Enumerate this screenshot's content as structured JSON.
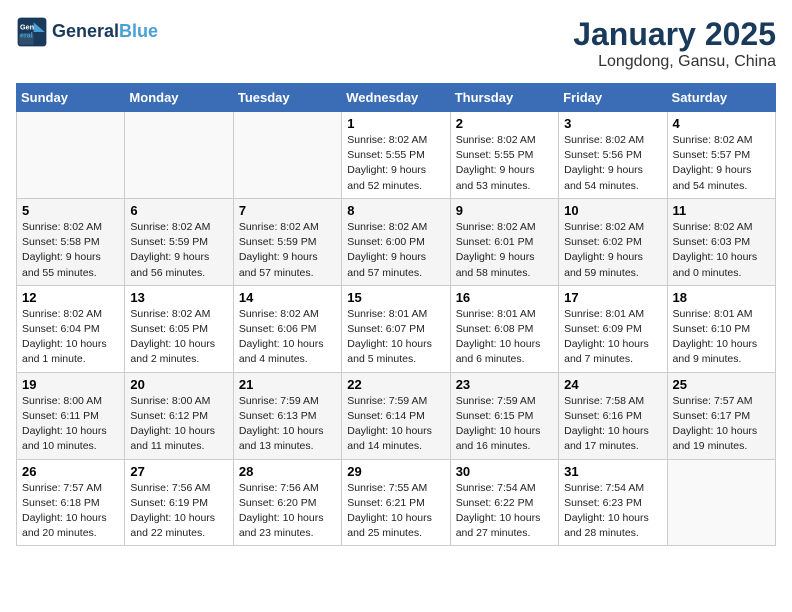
{
  "header": {
    "logo_line1": "General",
    "logo_line2": "Blue",
    "title": "January 2025",
    "subtitle": "Longdong, Gansu, China"
  },
  "weekdays": [
    "Sunday",
    "Monday",
    "Tuesday",
    "Wednesday",
    "Thursday",
    "Friday",
    "Saturday"
  ],
  "weeks": [
    [
      {
        "day": "",
        "info": ""
      },
      {
        "day": "",
        "info": ""
      },
      {
        "day": "",
        "info": ""
      },
      {
        "day": "1",
        "info": "Sunrise: 8:02 AM\nSunset: 5:55 PM\nDaylight: 9 hours and 52 minutes."
      },
      {
        "day": "2",
        "info": "Sunrise: 8:02 AM\nSunset: 5:55 PM\nDaylight: 9 hours and 53 minutes."
      },
      {
        "day": "3",
        "info": "Sunrise: 8:02 AM\nSunset: 5:56 PM\nDaylight: 9 hours and 54 minutes."
      },
      {
        "day": "4",
        "info": "Sunrise: 8:02 AM\nSunset: 5:57 PM\nDaylight: 9 hours and 54 minutes."
      }
    ],
    [
      {
        "day": "5",
        "info": "Sunrise: 8:02 AM\nSunset: 5:58 PM\nDaylight: 9 hours and 55 minutes."
      },
      {
        "day": "6",
        "info": "Sunrise: 8:02 AM\nSunset: 5:59 PM\nDaylight: 9 hours and 56 minutes."
      },
      {
        "day": "7",
        "info": "Sunrise: 8:02 AM\nSunset: 5:59 PM\nDaylight: 9 hours and 57 minutes."
      },
      {
        "day": "8",
        "info": "Sunrise: 8:02 AM\nSunset: 6:00 PM\nDaylight: 9 hours and 57 minutes."
      },
      {
        "day": "9",
        "info": "Sunrise: 8:02 AM\nSunset: 6:01 PM\nDaylight: 9 hours and 58 minutes."
      },
      {
        "day": "10",
        "info": "Sunrise: 8:02 AM\nSunset: 6:02 PM\nDaylight: 9 hours and 59 minutes."
      },
      {
        "day": "11",
        "info": "Sunrise: 8:02 AM\nSunset: 6:03 PM\nDaylight: 10 hours and 0 minutes."
      }
    ],
    [
      {
        "day": "12",
        "info": "Sunrise: 8:02 AM\nSunset: 6:04 PM\nDaylight: 10 hours and 1 minute."
      },
      {
        "day": "13",
        "info": "Sunrise: 8:02 AM\nSunset: 6:05 PM\nDaylight: 10 hours and 2 minutes."
      },
      {
        "day": "14",
        "info": "Sunrise: 8:02 AM\nSunset: 6:06 PM\nDaylight: 10 hours and 4 minutes."
      },
      {
        "day": "15",
        "info": "Sunrise: 8:01 AM\nSunset: 6:07 PM\nDaylight: 10 hours and 5 minutes."
      },
      {
        "day": "16",
        "info": "Sunrise: 8:01 AM\nSunset: 6:08 PM\nDaylight: 10 hours and 6 minutes."
      },
      {
        "day": "17",
        "info": "Sunrise: 8:01 AM\nSunset: 6:09 PM\nDaylight: 10 hours and 7 minutes."
      },
      {
        "day": "18",
        "info": "Sunrise: 8:01 AM\nSunset: 6:10 PM\nDaylight: 10 hours and 9 minutes."
      }
    ],
    [
      {
        "day": "19",
        "info": "Sunrise: 8:00 AM\nSunset: 6:11 PM\nDaylight: 10 hours and 10 minutes."
      },
      {
        "day": "20",
        "info": "Sunrise: 8:00 AM\nSunset: 6:12 PM\nDaylight: 10 hours and 11 minutes."
      },
      {
        "day": "21",
        "info": "Sunrise: 7:59 AM\nSunset: 6:13 PM\nDaylight: 10 hours and 13 minutes."
      },
      {
        "day": "22",
        "info": "Sunrise: 7:59 AM\nSunset: 6:14 PM\nDaylight: 10 hours and 14 minutes."
      },
      {
        "day": "23",
        "info": "Sunrise: 7:59 AM\nSunset: 6:15 PM\nDaylight: 10 hours and 16 minutes."
      },
      {
        "day": "24",
        "info": "Sunrise: 7:58 AM\nSunset: 6:16 PM\nDaylight: 10 hours and 17 minutes."
      },
      {
        "day": "25",
        "info": "Sunrise: 7:57 AM\nSunset: 6:17 PM\nDaylight: 10 hours and 19 minutes."
      }
    ],
    [
      {
        "day": "26",
        "info": "Sunrise: 7:57 AM\nSunset: 6:18 PM\nDaylight: 10 hours and 20 minutes."
      },
      {
        "day": "27",
        "info": "Sunrise: 7:56 AM\nSunset: 6:19 PM\nDaylight: 10 hours and 22 minutes."
      },
      {
        "day": "28",
        "info": "Sunrise: 7:56 AM\nSunset: 6:20 PM\nDaylight: 10 hours and 23 minutes."
      },
      {
        "day": "29",
        "info": "Sunrise: 7:55 AM\nSunset: 6:21 PM\nDaylight: 10 hours and 25 minutes."
      },
      {
        "day": "30",
        "info": "Sunrise: 7:54 AM\nSunset: 6:22 PM\nDaylight: 10 hours and 27 minutes."
      },
      {
        "day": "31",
        "info": "Sunrise: 7:54 AM\nSunset: 6:23 PM\nDaylight: 10 hours and 28 minutes."
      },
      {
        "day": "",
        "info": ""
      }
    ]
  ]
}
